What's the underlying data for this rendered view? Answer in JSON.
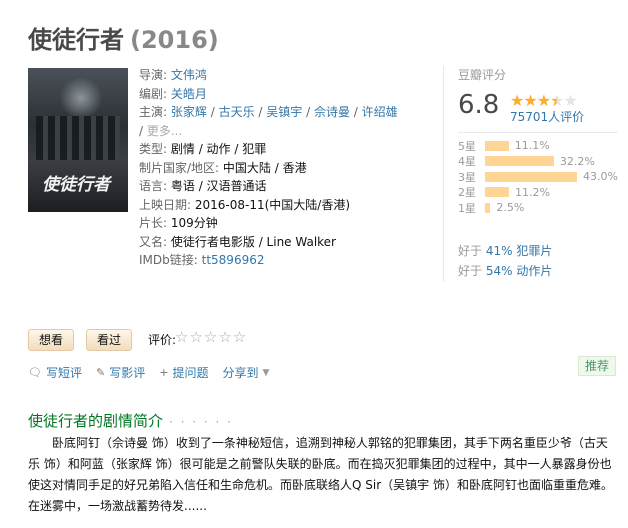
{
  "movie": {
    "title": "使徒行者",
    "year": "(2016)",
    "poster_title": "使徒行者"
  },
  "info": {
    "director_label": "导演:",
    "director": "文伟鸿",
    "writer_label": "编剧:",
    "writer": "关皓月",
    "cast_label": "主演:",
    "cast": [
      "张家辉",
      "古天乐",
      "吴镇宇",
      "佘诗曼",
      "许绍雄"
    ],
    "more": "更多...",
    "genre_label": "类型:",
    "genres": "剧情 / 动作 / 犯罪",
    "country_label": "制片国家/地区:",
    "country": "中国大陆 / 香港",
    "language_label": "语言:",
    "language": "粤语 / 汉语普通话",
    "release_label": "上映日期:",
    "release": "2016-08-11(中国大陆/香港)",
    "runtime_label": "片长:",
    "runtime": "109分钟",
    "aka_label": "又名:",
    "aka": "使徒行者电影版 / Line Walker",
    "imdb_label": "IMDb链接:",
    "imdb": "tt5896962"
  },
  "rating": {
    "label": "豆瓣评分",
    "score": "6.8",
    "stars_value": 3.5,
    "people": "75701人评价",
    "distribution": [
      {
        "label": "5星",
        "pct": "11.1%",
        "value": 11.1
      },
      {
        "label": "4星",
        "pct": "32.2%",
        "value": 32.2
      },
      {
        "label": "3星",
        "pct": "43.0%",
        "value": 43.0
      },
      {
        "label": "2星",
        "pct": "11.2%",
        "value": 11.2
      },
      {
        "label": "1星",
        "pct": "2.5%",
        "value": 2.5
      }
    ],
    "better1_prefix": "好于",
    "better1_link": "41% 犯罪片",
    "better2_prefix": "好于",
    "better2_link": "54% 动作片"
  },
  "buttons": {
    "want": "想看",
    "seen": "看过",
    "rate_label": "评价:",
    "rate_stars": "☆☆☆☆☆"
  },
  "actions": {
    "short_review": "写短评",
    "review": "写影评",
    "question": "提问题",
    "share": "分享到"
  },
  "recommend": "推荐",
  "summary": {
    "title": "使徒行者的剧情简介",
    "dots": "· · · · · ·",
    "text": "卧底阿钉（佘诗曼 饰）收到了一条神秘短信，追溯到神秘人郭铭的犯罪集团，其手下两名重臣少爷（古天乐 饰）和阿蓝（张家辉 饰）很可能是之前警队失联的卧底。而在捣灭犯罪集团的过程中，其中一人暴露身份也使这对情同手足的好兄弟陷入信任和生命危机。而卧底联络人Q Sir（吴镇宇 饰）和卧底阿钉也面临重重危难。在迷雾中，一场激战蓄势待发......"
  },
  "colors": {
    "link": "#3377aa",
    "green": "#007722",
    "star": "#ffac2d",
    "bar": "#ffd596"
  }
}
